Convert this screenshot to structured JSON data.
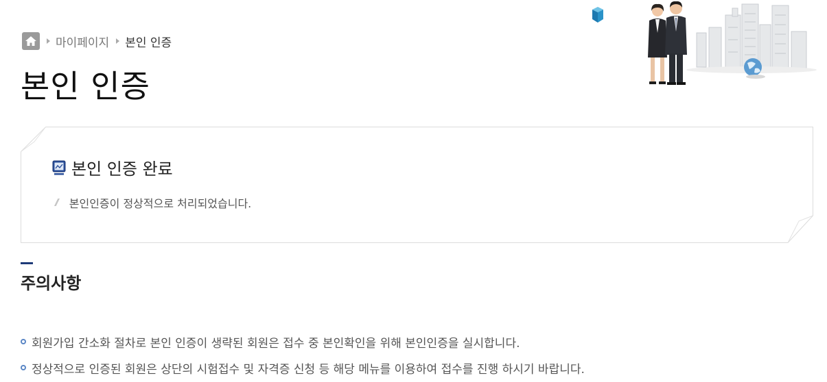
{
  "breadcrumb": {
    "home_icon": "home-icon",
    "items": [
      "마이페이지",
      "본인 인증"
    ]
  },
  "page": {
    "title": "본인 인증"
  },
  "notice": {
    "icon": "monitor-icon",
    "title": "본인 인증 완료",
    "message": "본인인증이 정상적으로 처리되었습니다."
  },
  "caution": {
    "title": "주의사항",
    "items": [
      "회원가입 간소화 절차로 본인 인증이 생략된 회원은 접수 중 본인확인을 위해 본인인증을 실시합니다.",
      "정상적으로 인증된 회원은 상단의 시험접수 및 자격증 신청 등 해당 메뉴를 이용하여 접수를 진행 하시기 바랍니다."
    ]
  },
  "colors": {
    "accent": "#1e3a78",
    "bullet": "#5a86c5",
    "border": "#dcdcdc"
  }
}
